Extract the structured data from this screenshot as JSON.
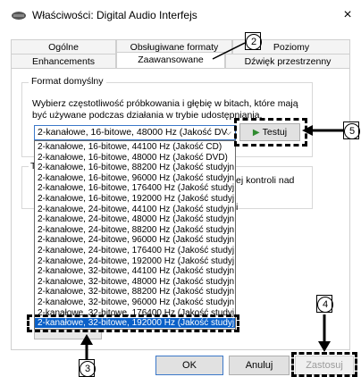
{
  "window": {
    "title": "Właściwości: Digital Audio Interfejs",
    "close_glyph": "×"
  },
  "tabs": [
    {
      "label": "Ogólne"
    },
    {
      "label": "Obsługiwane formaty"
    },
    {
      "label": "Poziomy"
    },
    {
      "label": "Enhancements"
    },
    {
      "label": "Zaawansowane"
    },
    {
      "label": "Dźwięk przestrzenny"
    }
  ],
  "selected_tab": "Zaawansowane",
  "default_format": {
    "legend": "Format domyślny",
    "description": "Wybierz częstotliwość próbkowania i głębię w bitach, które mają być używane podczas działania w trybie udostępniania.",
    "selected_value": "2-kanałowe, 16-bitowe, 48000 Hz (Jakość DV",
    "test_button": "Testuj"
  },
  "dropdown_options": [
    "2-kanałowe, 16-bitowe, 44100 Hz (Jakość CD)",
    "2-kanałowe, 16-bitowe, 48000 Hz (Jakość DVD)",
    "2-kanałowe, 16-bitowe, 88200 Hz (Jakość studyjn",
    "2-kanałowe, 16-bitowe, 96000 Hz (Jakość studyjn",
    "2-kanałowe, 16-bitowe, 176400 Hz (Jakość studyj",
    "2-kanałowe, 16-bitowe, 192000 Hz (Jakość studyj",
    "2-kanałowe, 24-bitowe, 44100 Hz (Jakość studyjn",
    "2-kanałowe, 24-bitowe, 48000 Hz (Jakość studyjn",
    "2-kanałowe, 24-bitowe, 88200 Hz (Jakość studyjn",
    "2-kanałowe, 24-bitowe, 96000 Hz (Jakość studyjn",
    "2-kanałowe, 24-bitowe, 176400 Hz (Jakość studyj",
    "2-kanałowe, 24-bitowe, 192000 Hz (Jakość studyj",
    "2-kanałowe, 32-bitowe, 44100 Hz (Jakość studyjn",
    "2-kanałowe, 32-bitowe, 48000 Hz (Jakość studyjn",
    "2-kanałowe, 32-bitowe, 88200 Hz (Jakość studyjn",
    "2-kanałowe, 32-bitowe, 96000 Hz (Jakość studyjn",
    "2-kanałowe, 32-bitowe, 176400 Hz (Jakość studyj",
    "2-kanałowe, 32-bitowe, 192000 Hz (Jakość studyj"
  ],
  "selected_option_index": 17,
  "background_group": {
    "legend_fragment": "T",
    "text_fragment": "ej kontroli nad",
    "text_fragment_2": "i"
  },
  "bottom_buttons": {
    "ok": "OK",
    "cancel": "Anuluj",
    "apply": "Zastosuj"
  },
  "annotations": {
    "n2": "2",
    "n3": "3",
    "n4": "4",
    "n5": "5"
  },
  "colors": {
    "selection": "#0a60c8",
    "focus_border": "#3c78c8",
    "play_icon": "#2f8b2f"
  }
}
